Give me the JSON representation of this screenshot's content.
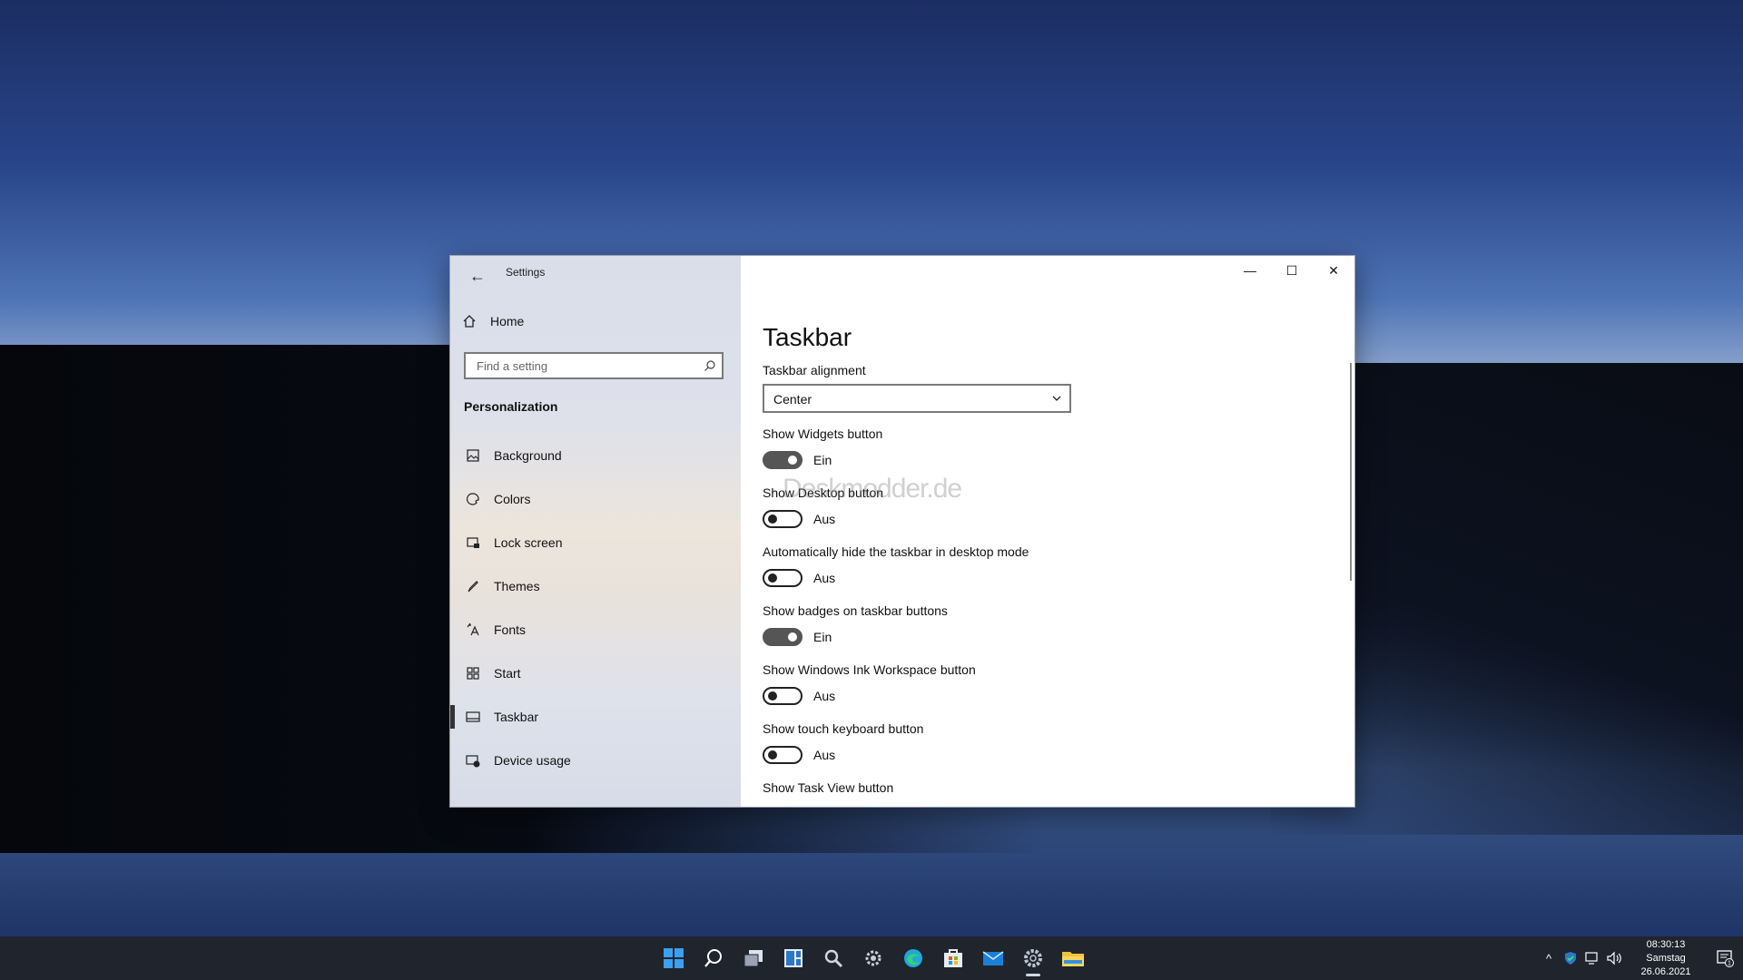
{
  "window": {
    "title": "Settings",
    "back_glyph": "←",
    "controls": {
      "minimize": "—",
      "maximize": "☐",
      "close": "✕"
    }
  },
  "sidebar": {
    "home_label": "Home",
    "search_placeholder": "Find a setting",
    "section_title": "Personalization",
    "items": [
      {
        "label": "Background",
        "icon": "background-icon"
      },
      {
        "label": "Colors",
        "icon": "colors-icon"
      },
      {
        "label": "Lock screen",
        "icon": "lock-screen-icon"
      },
      {
        "label": "Themes",
        "icon": "themes-icon"
      },
      {
        "label": "Fonts",
        "icon": "fonts-icon"
      },
      {
        "label": "Start",
        "icon": "start-icon"
      },
      {
        "label": "Taskbar",
        "icon": "taskbar-icon",
        "selected": true
      },
      {
        "label": "Device usage",
        "icon": "device-usage-icon"
      }
    ]
  },
  "main": {
    "title": "Taskbar",
    "alignment": {
      "label": "Taskbar alignment",
      "value": "Center"
    },
    "settings": [
      {
        "label": "Show Widgets button",
        "state": "Ein",
        "on": true
      },
      {
        "label": "Show Desktop button",
        "state": "Aus",
        "on": false
      },
      {
        "label": "Automatically hide the taskbar in desktop mode",
        "state": "Aus",
        "on": false
      },
      {
        "label": "Show badges on taskbar buttons",
        "state": "Ein",
        "on": true
      },
      {
        "label": "Show Windows Ink Workspace button",
        "state": "Aus",
        "on": false
      },
      {
        "label": "Show touch keyboard button",
        "state": "Aus",
        "on": false
      },
      {
        "label": "Show Task View button"
      }
    ],
    "watermark": "Deskmodder.de"
  },
  "taskbar": {
    "apps": [
      "start-icon",
      "search-icon",
      "task-view-icon",
      "widgets-icon",
      "magnifier-icon",
      "gear-tools-icon",
      "edge-icon",
      "store-icon",
      "mail-icon",
      "settings-icon",
      "file-explorer-icon"
    ],
    "clock": {
      "time": "08:30:13",
      "day": "Samstag",
      "date": "26.06.2021"
    },
    "tray_chevron": "^",
    "notification_count": "1",
    "colors": {
      "start": "#3aa0f0",
      "edge": "#1fa8d8",
      "folder": "#f2c23c",
      "mail": "#1a7fd8"
    }
  }
}
